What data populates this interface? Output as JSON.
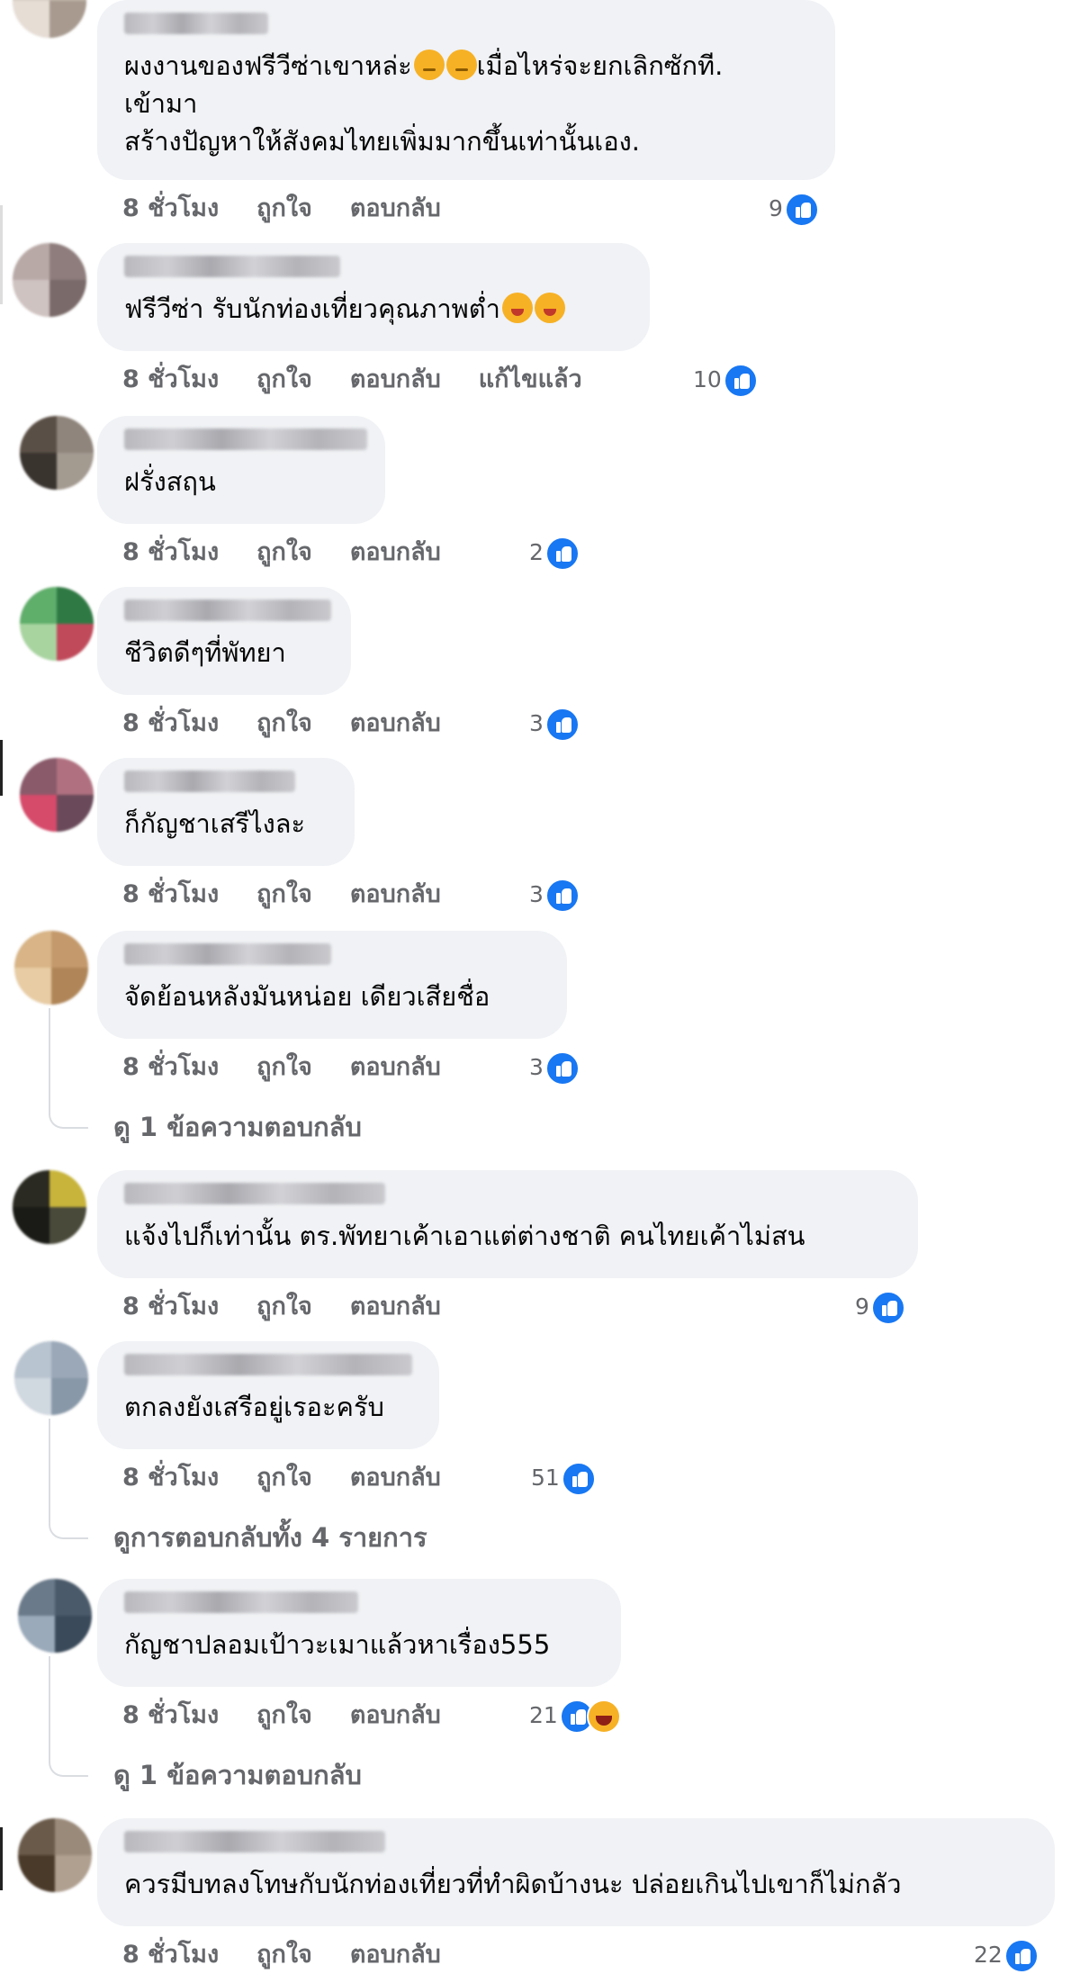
{
  "comments": [
    {
      "text": "ผงงานของฟรีวีซ่าเขาหล่ะ",
      "text_after": "เมื่อไหร่จะยกเลิกซักที.\nเข้ามา\nสร้างปัญหาให้สังคมไทยเพิ่มมากขึ้นเท่านั้นเอง.",
      "emojis": [
        "sad",
        "sad"
      ],
      "time": "8 ชั่วโมง",
      "like": "ถูกใจ",
      "reply": "ตอบกลับ",
      "edited": "",
      "reaction_count": "9",
      "avatar_colors": [
        "#d8cfc6",
        "#bfb3a8",
        "#e6ddd5",
        "#a89a8f"
      ]
    },
    {
      "text": "ฟรีวีซ่า รับนักท่องเที่ยวคุณภาพต่ำ",
      "text_after": "",
      "emojis": [
        "haha",
        "haha"
      ],
      "time": "8 ชั่วโมง",
      "like": "ถูกใจ",
      "reply": "ตอบกลับ",
      "edited": "แก้ไขแล้ว",
      "reaction_count": "10",
      "avatar_colors": [
        "#b8a9a6",
        "#8e7d7c",
        "#cfc3c1",
        "#7a6a69"
      ]
    },
    {
      "text": "ฝรั่งสฤน",
      "text_after": "",
      "emojis": [],
      "time": "8 ชั่วโมง",
      "like": "ถูกใจ",
      "reply": "ตอบกลับ",
      "edited": "",
      "reaction_count": "2",
      "avatar_colors": [
        "#5a4f46",
        "#8f857c",
        "#3a342f",
        "#a39a90"
      ]
    },
    {
      "text": "ชีวิตดีๆที่พัทยา",
      "text_after": "",
      "emojis": [],
      "time": "8 ชั่วโมง",
      "like": "ถูกใจ",
      "reply": "ตอบกลับ",
      "edited": "",
      "reaction_count": "3",
      "avatar_colors": [
        "#5fae6a",
        "#2f7a44",
        "#a8d4a0",
        "#c04a5a"
      ]
    },
    {
      "text": "ก็กัญชาเสรีไงละ",
      "text_after": "",
      "emojis": [],
      "time": "8 ชั่วโมง",
      "like": "ถูกใจ",
      "reply": "ตอบกลับ",
      "edited": "",
      "reaction_count": "3",
      "avatar_colors": [
        "#8a5a6a",
        "#b07080",
        "#d64a6a",
        "#6a4a5a"
      ]
    },
    {
      "text": "จัดย้อนหลังมันหน่อย เดียวเสียชื่อ",
      "text_after": "",
      "emojis": [],
      "time": "8 ชั่วโมง",
      "like": "ถูกใจ",
      "reply": "ตอบกลับ",
      "edited": "",
      "reaction_count": "3",
      "avatar_colors": [
        "#d8b486",
        "#c49a6c",
        "#e8cca4",
        "#b08658"
      ],
      "view_replies": "ดู 1 ข้อความตอบกลับ"
    },
    {
      "text": "แจ้งไปก็เท่านั้น ตร.พัทยาเค้าเอาแต่ต่างชาติ คนไทยเค้าไม่สน",
      "text_after": "",
      "emojis": [],
      "time": "8 ชั่วโมง",
      "like": "ถูกใจ",
      "reply": "ตอบกลับ",
      "edited": "",
      "reaction_count": "9",
      "avatar_colors": [
        "#2a2a22",
        "#c8b43a",
        "#1a1a16",
        "#4a4a3a"
      ]
    },
    {
      "text": "ตกลงยังเสรีอยู่เรอะครับ",
      "text_after": "",
      "emojis": [],
      "time": "8 ชั่วโมง",
      "like": "ถูกใจ",
      "reply": "ตอบกลับ",
      "edited": "",
      "reaction_count": "51",
      "avatar_colors": [
        "#b8c4d0",
        "#9aa8b8",
        "#d0d8e0",
        "#8898a8"
      ],
      "view_replies": "ดูการตอบกลับทั้ง 4 รายการ"
    },
    {
      "text": "กัญชาปลอมเป้าวะเมาแล้วหาเรื่อง555",
      "text_after": "",
      "emojis": [],
      "time": "8 ชั่วโมง",
      "like": "ถูกใจ",
      "reply": "ตอบกลับ",
      "edited": "",
      "reaction_count": "21",
      "avatar_colors": [
        "#6a7a8a",
        "#4a5a6a",
        "#9aaaba",
        "#3a4a5a"
      ],
      "view_replies": "ดู 1 ข้อความตอบกลับ",
      "has_haha": true
    },
    {
      "text": "ควรมีบทลงโทษกับนักท่องเที่ยวที่ทำผิดบ้างนะ ปล่อยเกินไปเขาก็ไม่กลัว",
      "text_after": "",
      "emojis": [],
      "time": "8 ชั่วโมง",
      "like": "ถูกใจ",
      "reply": "ตอบกลับ",
      "edited": "",
      "reaction_count": "22",
      "avatar_colors": [
        "#6a5a4a",
        "#9a8a7a",
        "#4a3a2a",
        "#b0a090"
      ]
    }
  ]
}
